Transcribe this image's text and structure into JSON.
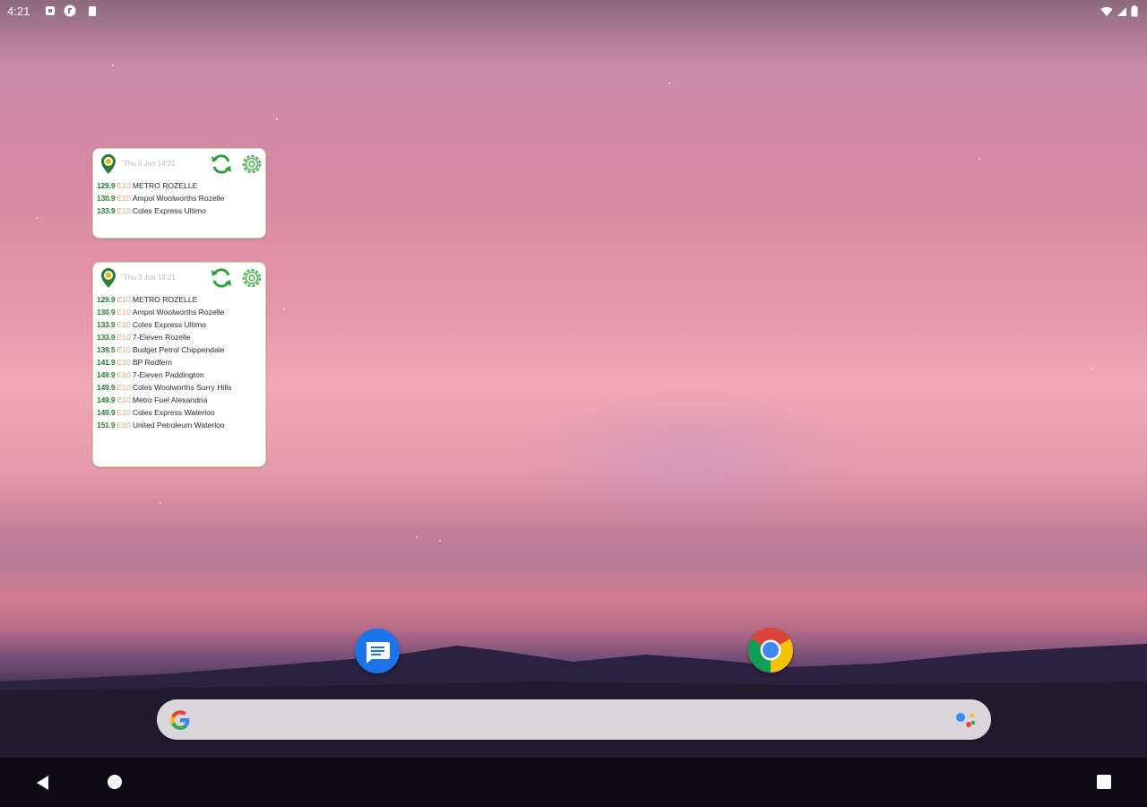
{
  "status_bar": {
    "time": "4:21"
  },
  "widgets": [
    {
      "date": "Thu 3 Jun 14:21",
      "rows": [
        {
          "price": "129.9",
          "fuel": "E10",
          "station": "METRO ROZELLE"
        },
        {
          "price": "130.9",
          "fuel": "E10",
          "station": "Ampol Woolworths Rozelle"
        },
        {
          "price": "133.9",
          "fuel": "E10",
          "station": "Coles Express Ultimo"
        }
      ]
    },
    {
      "date": "Thu 3 Jun 14:21",
      "rows": [
        {
          "price": "129.9",
          "fuel": "E10",
          "station": "METRO ROZELLE"
        },
        {
          "price": "130.9",
          "fuel": "E10",
          "station": "Ampol Woolworths Rozelle"
        },
        {
          "price": "133.9",
          "fuel": "E10",
          "station": "Coles Express Ultimo"
        },
        {
          "price": "133.9",
          "fuel": "E10",
          "station": "7-Eleven Rozelle"
        },
        {
          "price": "139.5",
          "fuel": "E10",
          "station": "Budget Petrol Chippendale"
        },
        {
          "price": "141.9",
          "fuel": "E10",
          "station": "BP Redfern"
        },
        {
          "price": "149.9",
          "fuel": "E10",
          "station": "7-Eleven Paddington"
        },
        {
          "price": "149.9",
          "fuel": "E10",
          "station": "Coles Woolworths Surry Hills"
        },
        {
          "price": "149.9",
          "fuel": "E10",
          "station": "Metro Fuel Alexandria"
        },
        {
          "price": "149.9",
          "fuel": "E10",
          "station": "Coles Express Waterloo"
        },
        {
          "price": "151.9",
          "fuel": "E10",
          "station": "United Petroleum Waterloo"
        }
      ]
    }
  ],
  "dock": {
    "apps": [
      "messages-icon",
      "chrome-icon"
    ]
  },
  "search": {
    "placeholder": ""
  },
  "colors": {
    "price": "#2e7d32",
    "fuel": "#f0a070",
    "accent": "#1a73e8"
  }
}
